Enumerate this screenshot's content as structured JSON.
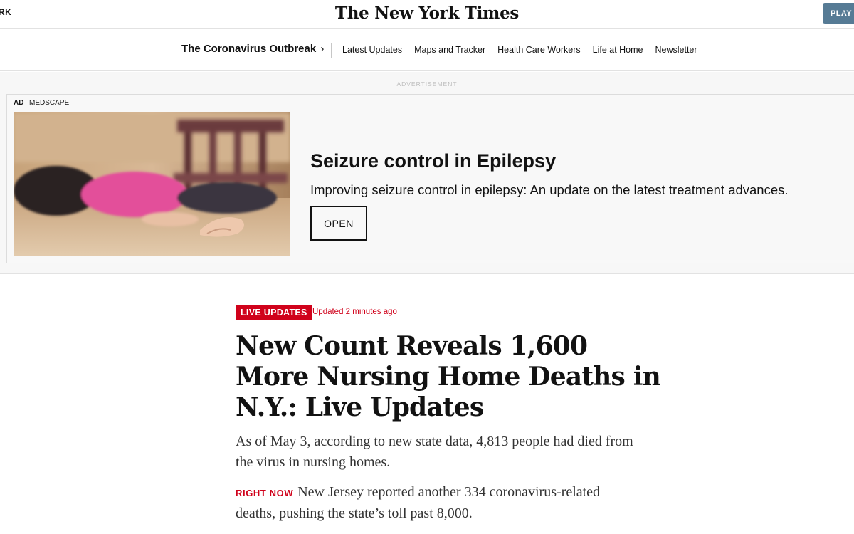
{
  "masthead": {
    "left_text": "RK",
    "logo": "The New York Times",
    "play_button": "PLAY T"
  },
  "subnav": {
    "section_title": "The Coronavirus Outbreak",
    "section_chevron": "›",
    "links": [
      "Latest Updates",
      "Maps and Tracker",
      "Health Care Workers",
      "Life at Home",
      "Newsletter"
    ]
  },
  "ad": {
    "zone_label": "ADVERTISEMENT",
    "tag": "AD",
    "sponsor": "MEDSCAPE",
    "headline": "Seizure control in Epilepsy",
    "description": "Improving seizure control in epilepsy: An update on the latest treatment advances.",
    "cta": "OPEN"
  },
  "article": {
    "badge": "LIVE UPDATES",
    "updated": "Updated 2 minutes ago",
    "headline": "New Count Reveals 1,600 More Nursing Home Deaths in N.Y.: Live Updates",
    "summary": "As of May 3, according to new state data, 4,813 people had died from the virus in nursing homes.",
    "right_now_label": "RIGHT NOW",
    "right_now_text": "New Jersey reported another 334 coronavirus-related deaths, pushing the state’s toll past 8,000."
  }
}
